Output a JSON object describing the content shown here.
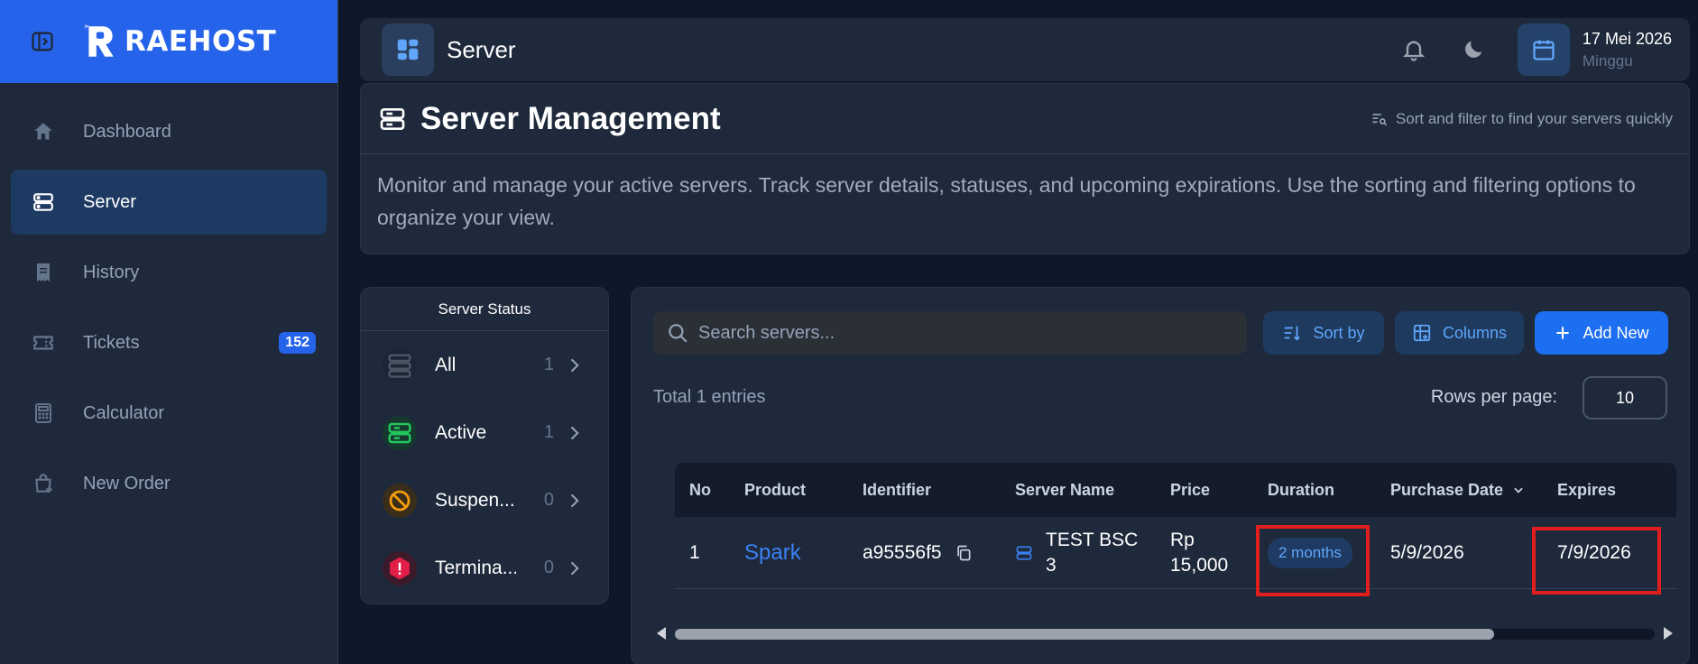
{
  "brand": {
    "name": "RAEHOST"
  },
  "sidebar": {
    "items": [
      {
        "label": "Dashboard",
        "icon": "home-icon"
      },
      {
        "label": "Server",
        "icon": "server-icon"
      },
      {
        "label": "History",
        "icon": "receipt-icon"
      },
      {
        "label": "Tickets",
        "icon": "ticket-icon",
        "badge": "152"
      },
      {
        "label": "Calculator",
        "icon": "calculator-icon"
      },
      {
        "label": "New Order",
        "icon": "shopping-bag-plus-icon"
      }
    ]
  },
  "topbar": {
    "title": "Server",
    "date": "17 Mei 2026",
    "day": "Minggu"
  },
  "header": {
    "title": "Server Management",
    "hint": "Sort and filter to find your servers quickly",
    "description": "Monitor and manage your active servers. Track server details, statuses, and upcoming expirations. Use the sorting and filtering options to organize your view."
  },
  "status": {
    "title": "Server Status",
    "items": [
      {
        "label": "All",
        "count": "1"
      },
      {
        "label": "Active",
        "count": "1"
      },
      {
        "label": "Suspen...",
        "count": "0"
      },
      {
        "label": "Termina...",
        "count": "0"
      }
    ]
  },
  "toolbar": {
    "search_placeholder": "Search servers...",
    "sort_label": "Sort by",
    "columns_label": "Columns",
    "add_label": "Add New"
  },
  "list": {
    "total": "Total 1 entries",
    "rows_per_page_label": "Rows per page:",
    "rows_per_page": "10"
  },
  "table": {
    "headers": [
      "No",
      "Product",
      "Identifier",
      "Server Name",
      "Price",
      "Duration",
      "Purchase Date",
      "Expires"
    ],
    "rows": [
      {
        "no": "1",
        "product": "Spark",
        "identifier": "a95556f5",
        "server_name": "TEST BSC 3",
        "price": "Rp 15,000",
        "duration": "2 months",
        "purchase_date": "5/9/2026",
        "expires": "7/9/2026"
      }
    ]
  },
  "colors": {
    "accent": "#2563eb",
    "highlight": "#e11d1d"
  }
}
